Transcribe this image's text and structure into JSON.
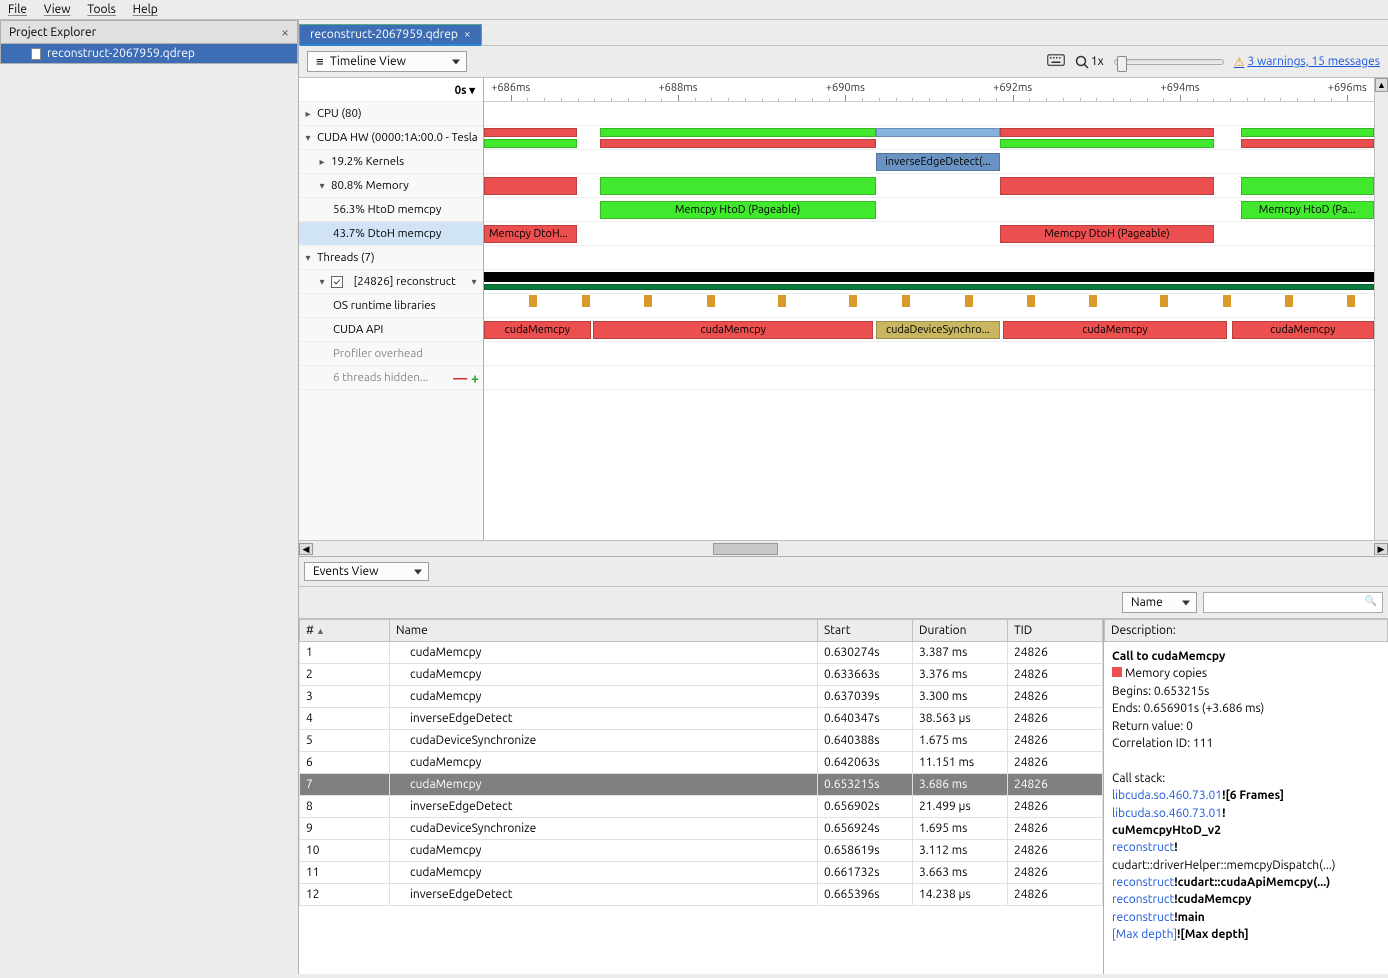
{
  "menu": {
    "file": "File",
    "view": "View",
    "tools": "Tools",
    "help": "Help"
  },
  "sidebar": {
    "title": "Project Explorer",
    "file": "reconstruct-2067959.qdrep"
  },
  "tab": {
    "label": "reconstruct-2067959.qdrep"
  },
  "toolbar": {
    "timeline": "Timeline View",
    "zoom": "1x",
    "warn": "3 warnings, 15 messages"
  },
  "axis": {
    "origin": "0s ▾",
    "ticks": [
      "+686ms",
      "+688ms",
      "+690ms",
      "+692ms",
      "+694ms",
      "+696ms"
    ]
  },
  "tree": {
    "cpu": "CPU (80)",
    "cuda": "CUDA HW (0000:1A:00.0 - Tesla",
    "kernels": "19.2% Kernels",
    "memory": "80.8% Memory",
    "htod": "56.3% HtoD memcpy",
    "dtoh": "43.7% DtoH memcpy",
    "threads": "Threads (7)",
    "thread": "[24826] reconstruct",
    "os": "OS runtime libraries",
    "api": "CUDA API",
    "prof": "Profiler overhead",
    "hidden": "6 threads hidden..."
  },
  "segs": {
    "inverse": "inverseEdgeDetect(...",
    "htod_page": "Memcpy HtoD (Pageable)",
    "htod_page2": "Memcpy HtoD (Pa...",
    "dtoh_short": "Memcpy DtoH...",
    "dtoh_page": "Memcpy DtoH (Pageable)",
    "cmemcpy": "cudaMemcpy",
    "csync": "cudaDeviceSynchro..."
  },
  "events": {
    "title": "Events View",
    "filter": "Name",
    "cols": {
      "num": "#",
      "name": "Name",
      "start": "Start",
      "dur": "Duration",
      "tid": "TID"
    },
    "rows": [
      {
        "n": "1",
        "name": "cudaMemcpy",
        "start": "0.630274s",
        "dur": "3.387 ms",
        "tid": "24826"
      },
      {
        "n": "2",
        "name": "cudaMemcpy",
        "start": "0.633663s",
        "dur": "3.376 ms",
        "tid": "24826"
      },
      {
        "n": "3",
        "name": "cudaMemcpy",
        "start": "0.637039s",
        "dur": "3.300 ms",
        "tid": "24826"
      },
      {
        "n": "4",
        "name": "inverseEdgeDetect",
        "start": "0.640347s",
        "dur": "38.563 µs",
        "tid": "24826"
      },
      {
        "n": "5",
        "name": "cudaDeviceSynchronize",
        "start": "0.640388s",
        "dur": "1.675 ms",
        "tid": "24826"
      },
      {
        "n": "6",
        "name": "cudaMemcpy",
        "start": "0.642063s",
        "dur": "11.151 ms",
        "tid": "24826"
      },
      {
        "n": "7",
        "name": "cudaMemcpy",
        "start": "0.653215s",
        "dur": "3.686 ms",
        "tid": "24826",
        "sel": true
      },
      {
        "n": "8",
        "name": "inverseEdgeDetect",
        "start": "0.656902s",
        "dur": "21.499 µs",
        "tid": "24826"
      },
      {
        "n": "9",
        "name": "cudaDeviceSynchronize",
        "start": "0.656924s",
        "dur": "1.695 ms",
        "tid": "24826"
      },
      {
        "n": "10",
        "name": "cudaMemcpy",
        "start": "0.658619s",
        "dur": "3.112 ms",
        "tid": "24826"
      },
      {
        "n": "11",
        "name": "cudaMemcpy",
        "start": "0.661732s",
        "dur": "3.663 ms",
        "tid": "24826"
      },
      {
        "n": "12",
        "name": "inverseEdgeDetect",
        "start": "0.665396s",
        "dur": "14.238 µs",
        "tid": "24826"
      }
    ]
  },
  "desc": {
    "hdr": "Description:",
    "title": "Call to cudaMemcpy",
    "memcopies": "Memory copies",
    "begins": "Begins: 0.653215s",
    "ends": "Ends: 0.656901s (+3.686 ms)",
    "ret": "Return value: 0",
    "corr": "Correlation ID: 111",
    "stack_hdr": "Call stack:",
    "s1a": "libcuda.so.460.73.01",
    "s1b": "![6 Frames]",
    "s2a": "libcuda.so.460.73.01",
    "s2b": "!",
    "s3": "cuMemcpyHtoD_v2",
    "s4a": "reconstruct",
    "s4b": "!",
    "s5": "cudart::driverHelper::memcpyDispatch(...)",
    "s6a": "reconstruct",
    "s6b": "!cudart::cudaApiMemcpy(...)",
    "s7a": "reconstruct",
    "s7b": "!cudaMemcpy",
    "s8a": "reconstruct",
    "s8b": "!main",
    "s9a": "[Max depth]",
    "s9b": "![Max depth]"
  }
}
